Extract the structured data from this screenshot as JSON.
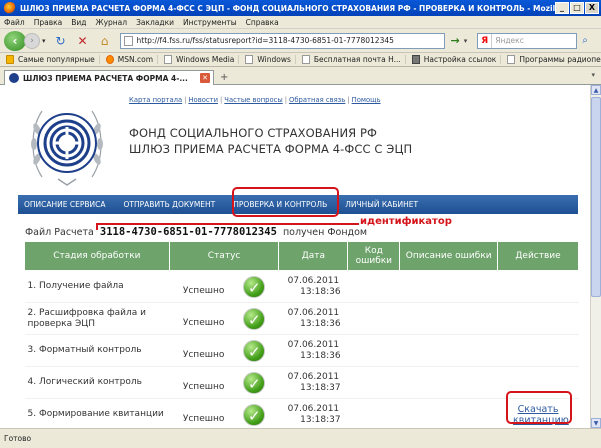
{
  "window": {
    "title": "ШЛЮЗ ПРИЕМА РАСЧЕТА ФОРМА 4-ФСС С ЭЦП - ФОНД СОЦИАЛЬНОГО СТРАХОВАНИЯ РФ - ПРОВЕРКА И КОНТРОЛЬ - Mozilla Firefox",
    "minimize": "_",
    "maximize": "□",
    "close": "X"
  },
  "menu": [
    "Файл",
    "Правка",
    "Вид",
    "Журнал",
    "Закладки",
    "Инструменты",
    "Справка"
  ],
  "nav": {
    "url": "http://f4.fss.ru/fss/statusreport?id=3118-4730-6851-01-7778012345",
    "search_placeholder": "Яндекс",
    "search_logo": "Я"
  },
  "bookmarks": [
    "Самые популярные",
    "MSN.com",
    "Windows Media",
    "Windows",
    "Бесплатная почта H...",
    "Настройка ссылок",
    "Программы радиопе..."
  ],
  "tab": {
    "label": "ШЛЮЗ ПРИЕМА РАСЧЕТА ФОРМА 4-..."
  },
  "page": {
    "top_links": [
      "Карта портала",
      "Новости",
      "Частые вопросы",
      "Обратная связь",
      "Помощь"
    ],
    "org_line1": "ФОНД СОЦИАЛЬНОГО СТРАХОВАНИЯ РФ",
    "org_line2": "ШЛЮЗ ПРИЕМА РАСЧЕТА ФОРМА 4-ФСС С ЭЦП",
    "site_nav": [
      "ОПИСАНИЕ СЕРВИСА",
      "ОТПРАВИТЬ ДОКУМЕНТ",
      "ПРОВЕРКА И КОНТРОЛЬ",
      "ЛИЧНЫЙ КАБИНЕТ"
    ],
    "annotation": "идентификатор",
    "file_prefix": "Файл Расчета",
    "file_id": "3118-4730-6851-01-7778012345",
    "file_suffix": "получен Фондом",
    "table": {
      "headers": [
        "Стадия обработки",
        "Статус",
        "Дата",
        "Код ошибки",
        "Описание ошибки",
        "Действие"
      ],
      "rows": [
        {
          "stage": "1. Получение файла",
          "status": "Успешно",
          "date": "07.06.2011",
          "time": "13:18:36"
        },
        {
          "stage": "2. Расшифровка файла и проверка ЭЦП",
          "status": "Успешно",
          "date": "07.06.2011",
          "time": "13:18:36"
        },
        {
          "stage": "3. Форматный контроль",
          "status": "Успешно",
          "date": "07.06.2011",
          "time": "13:18:36"
        },
        {
          "stage": "4. Логический контроль",
          "status": "Успешно",
          "date": "07.06.2011",
          "time": "13:18:37"
        },
        {
          "stage": "5. Формирование квитанции",
          "status": "Успешно",
          "date": "07.06.2011",
          "time": "13:18:37",
          "action": "Скачать квитанцию"
        }
      ]
    }
  },
  "statusbar": "Готово",
  "colors": {
    "accent_red": "#d4141a",
    "nav_blue": "#1e4f92",
    "table_green": "#6fa36c",
    "link_blue": "#2d5a9e"
  }
}
